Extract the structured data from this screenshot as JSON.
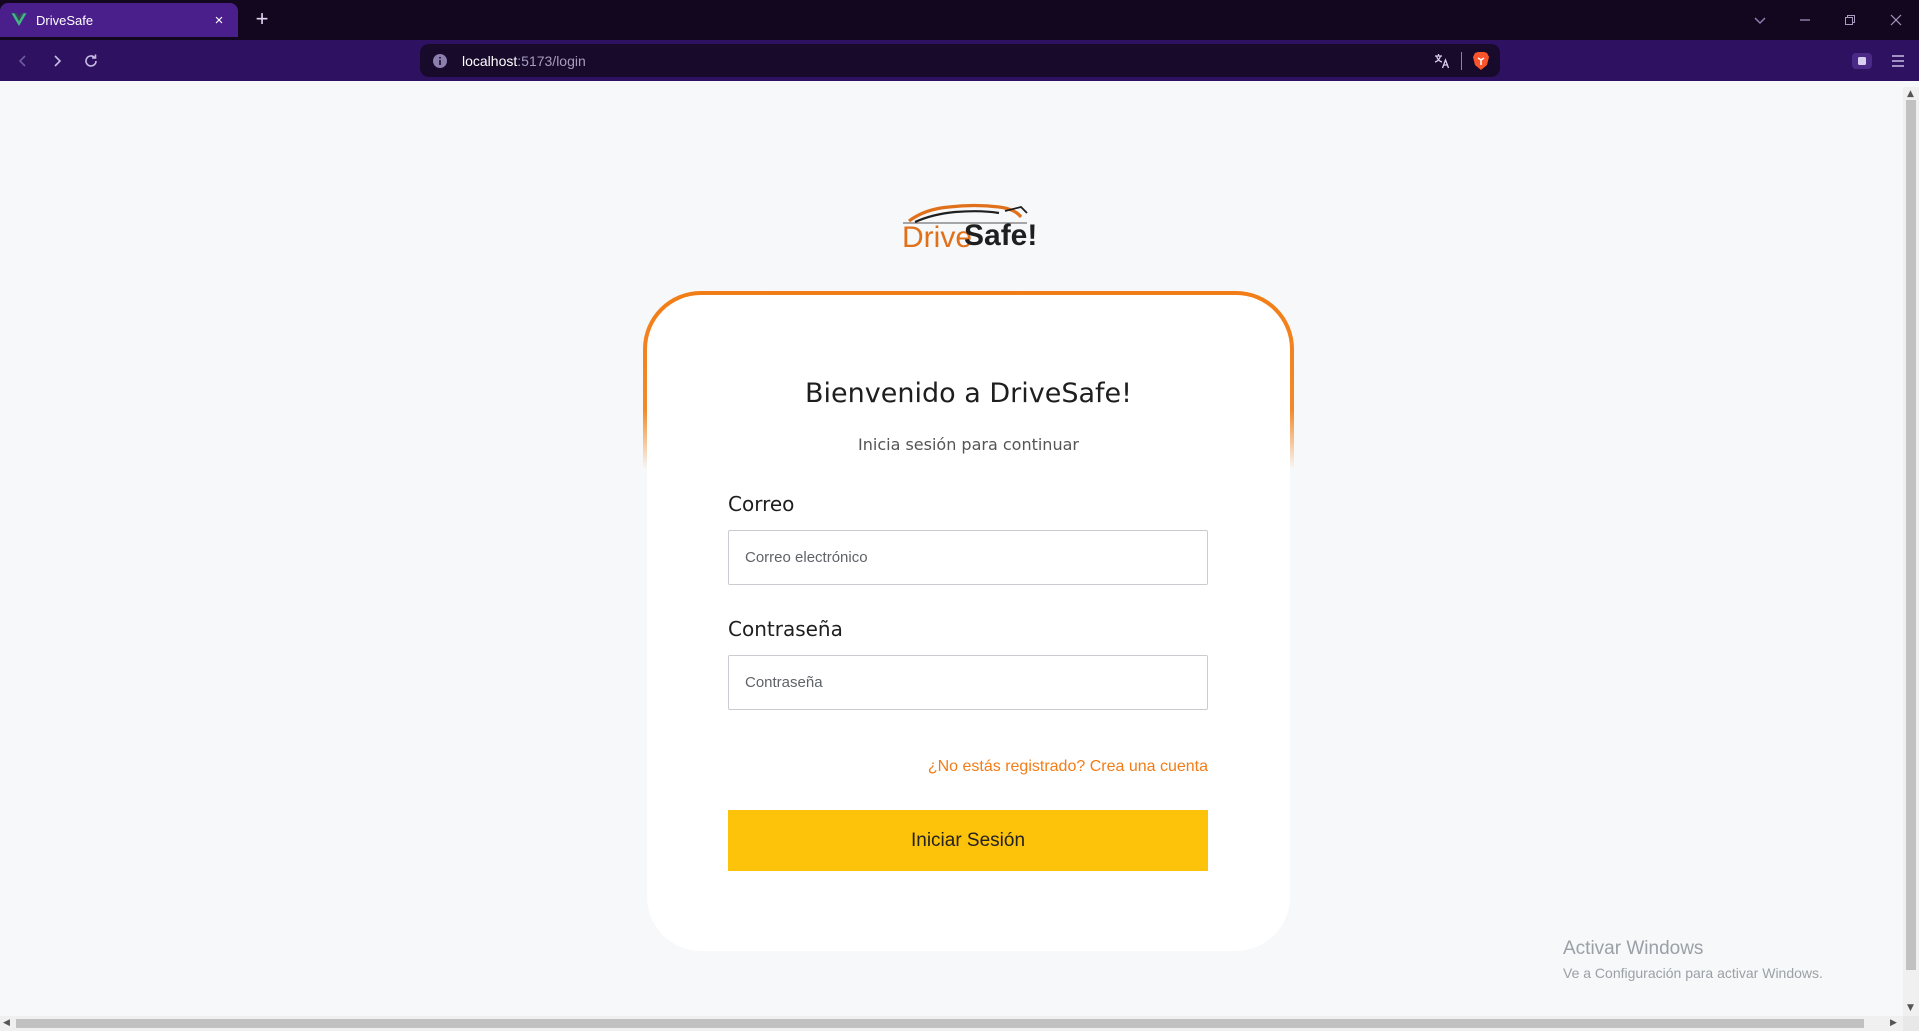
{
  "browser": {
    "tab_title": "DriveSafe",
    "tab_close": "×",
    "new_tab": "+",
    "url_host": "localhost",
    "url_path": ":5173/login"
  },
  "logo": {
    "part1": "Drive",
    "part2": "Safe!"
  },
  "login": {
    "title": "Bienvenido a DriveSafe!",
    "subtitle": "Inicia sesión para continuar",
    "email_label": "Correo",
    "email_placeholder": "Correo electrónico",
    "email_value": "",
    "password_label": "Contraseña",
    "password_placeholder": "Contraseña",
    "password_value": "",
    "register_link": "¿No estás registrado? Crea una cuenta",
    "submit_label": "Iniciar Sesión"
  },
  "watermark": {
    "title": "Activar Windows",
    "subtitle": "Ve a Configuración para activar Windows."
  },
  "colors": {
    "accent_orange": "#f27d16",
    "button_yellow": "#fdc20a",
    "browser_purple": "#2e1160"
  }
}
